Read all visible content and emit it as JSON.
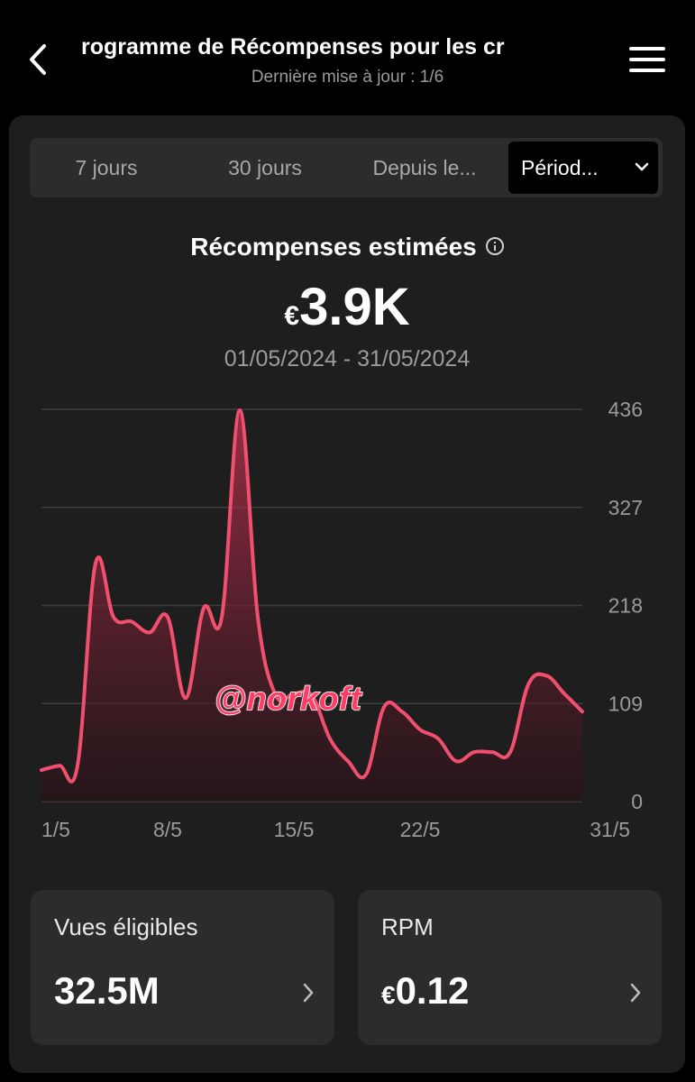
{
  "header": {
    "title": "rogramme de Récompenses pour les cr",
    "subtitle": "Dernière mise à jour : 1/6"
  },
  "tabs": [
    {
      "label": "7 jours"
    },
    {
      "label": "30 jours"
    },
    {
      "label": "Depuis le..."
    },
    {
      "label": "Périod...",
      "selected": true
    }
  ],
  "summary": {
    "title": "Récompenses estimées",
    "currency": "€",
    "amount": "3.9K",
    "range": "01/05/2024 - 31/05/2024"
  },
  "chart_data": {
    "type": "area",
    "title": "",
    "xlabel": "",
    "ylabel": "",
    "x_tick_labels": [
      "1/5",
      "8/5",
      "15/5",
      "22/5",
      "31/5"
    ],
    "y_tick_labels": [
      "436",
      "327",
      "218",
      "109",
      "0"
    ],
    "ylim": [
      0,
      436
    ],
    "grid": true,
    "color": "#f0506e",
    "series": [
      {
        "x": [
          1,
          2,
          3,
          4,
          5,
          6,
          7,
          8,
          9,
          10,
          11,
          12,
          13,
          14,
          15,
          16,
          17,
          18,
          19,
          20,
          21,
          22,
          23,
          24,
          25,
          26,
          27,
          28,
          29,
          30,
          31
        ],
        "values": [
          35,
          40,
          40,
          265,
          205,
          200,
          188,
          205,
          115,
          215,
          205,
          435,
          205,
          118,
          120,
          118,
          70,
          45,
          30,
          105,
          100,
          80,
          70,
          45,
          55,
          55,
          55,
          130,
          140,
          120,
          100
        ]
      }
    ]
  },
  "watermark": "@norkoft",
  "stats": [
    {
      "label": "Vues éligibles",
      "currency": "",
      "value": "32.5M"
    },
    {
      "label": "RPM",
      "currency": "€",
      "value": "0.12"
    }
  ],
  "icons": {
    "back": "chevron-left-icon",
    "menu": "menu-icon",
    "info": "info-icon",
    "dropdown": "chevron-down-icon",
    "stat_arrow": "chevron-right-icon"
  }
}
